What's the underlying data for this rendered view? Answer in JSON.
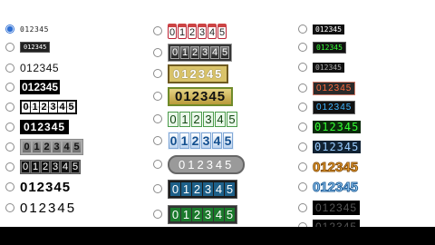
{
  "digits": "012345",
  "column1": [
    {
      "style": "s1",
      "checked": true
    },
    {
      "style": "s2",
      "checked": false
    },
    {
      "style": "s3",
      "checked": false
    },
    {
      "style": "s4",
      "checked": false
    },
    {
      "style": "s5",
      "checked": false
    },
    {
      "style": "s6",
      "checked": false
    },
    {
      "style": "s7",
      "checked": false
    },
    {
      "style": "s8",
      "checked": false
    },
    {
      "style": "s9",
      "checked": false
    },
    {
      "style": "s10",
      "checked": false
    }
  ],
  "column2": [
    {
      "style": "t1",
      "checked": false
    },
    {
      "style": "t2",
      "checked": false
    },
    {
      "style": "t3",
      "checked": false
    },
    {
      "style": "t4",
      "checked": false
    },
    {
      "style": "t5",
      "checked": false
    },
    {
      "style": "t6",
      "checked": false
    },
    {
      "style": "t7",
      "checked": false
    },
    {
      "style": "t8",
      "checked": false
    },
    {
      "style": "t9",
      "checked": false
    }
  ],
  "column3": [
    {
      "style": "u1",
      "checked": false
    },
    {
      "style": "u2",
      "checked": false
    },
    {
      "style": "u3",
      "checked": false
    },
    {
      "style": "u4",
      "checked": false
    },
    {
      "style": "u5",
      "checked": false
    },
    {
      "style": "u6",
      "checked": false
    },
    {
      "style": "u7",
      "checked": false
    },
    {
      "style": "u8",
      "checked": false
    },
    {
      "style": "u9",
      "checked": false
    },
    {
      "style": "u10",
      "checked": false
    },
    {
      "style": "u11",
      "checked": false
    }
  ]
}
